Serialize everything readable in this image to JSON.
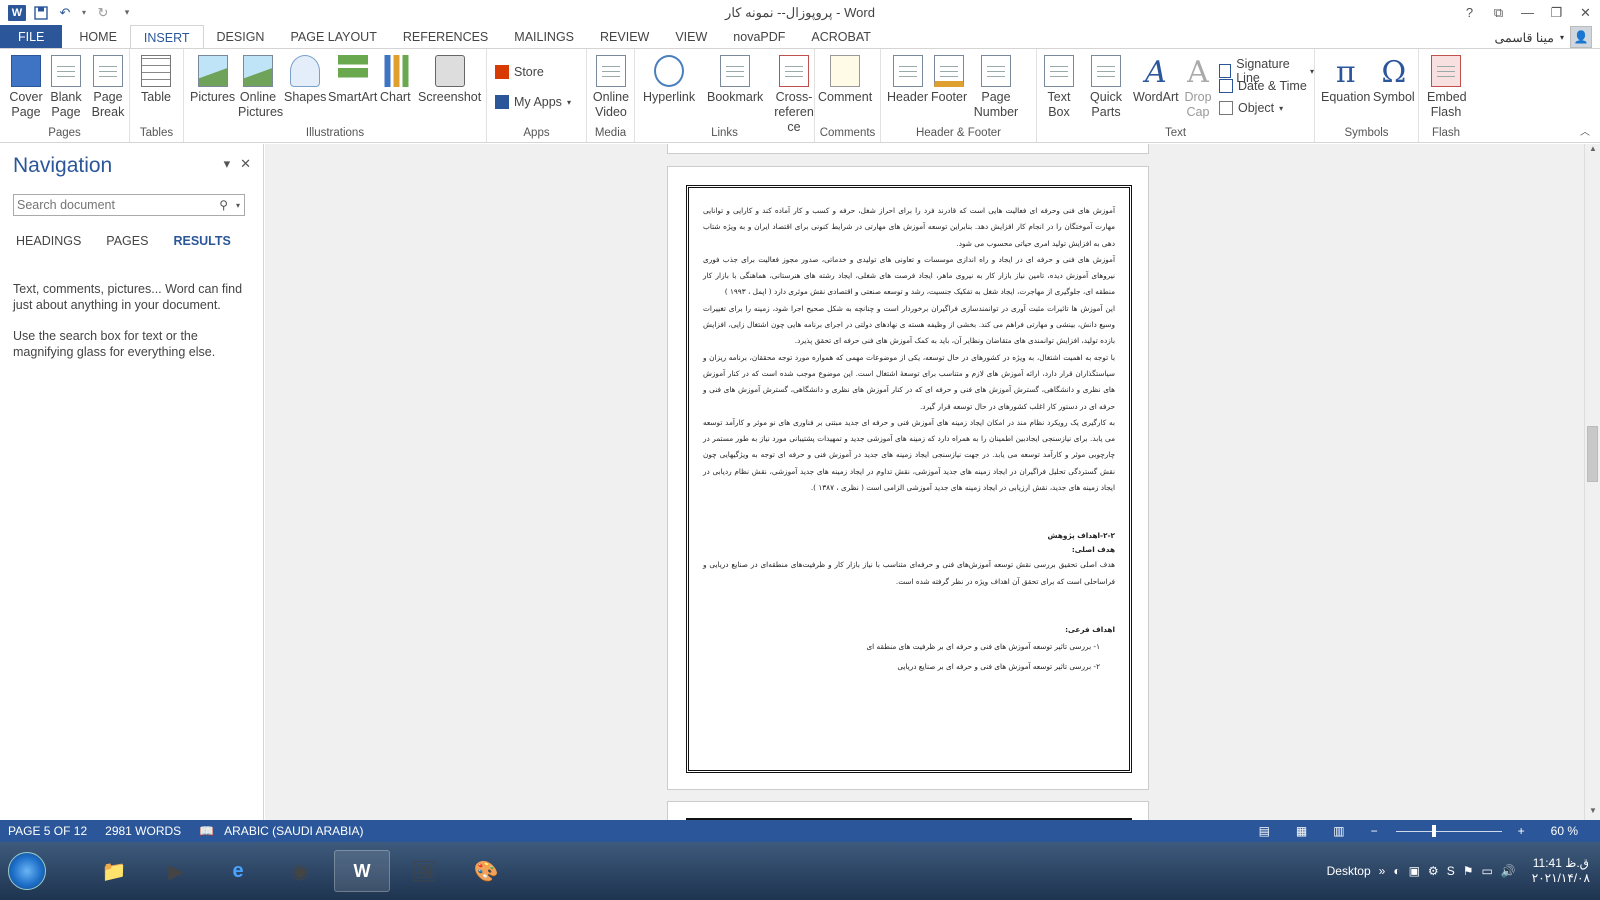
{
  "titlebar": {
    "title": "پروپوزال-- نمونه کار - Word",
    "word_logo": "W",
    "help": "?",
    "restore_ribbon": "⧉",
    "minimize": "—",
    "maximize": "❐",
    "close": "✕"
  },
  "tabs": [
    {
      "label": "FILE"
    },
    {
      "label": "HOME"
    },
    {
      "label": "INSERT"
    },
    {
      "label": "DESIGN"
    },
    {
      "label": "PAGE LAYOUT"
    },
    {
      "label": "REFERENCES"
    },
    {
      "label": "MAILINGS"
    },
    {
      "label": "REVIEW"
    },
    {
      "label": "VIEW"
    },
    {
      "label": "novaPDF"
    },
    {
      "label": "ACROBAT"
    }
  ],
  "active_tab": "INSERT",
  "user": {
    "name": "مینا قاسمی"
  },
  "ribbon": {
    "groups": {
      "pages": "Pages",
      "tables": "Tables",
      "illustrations": "Illustrations",
      "apps": "Apps",
      "media": "Media",
      "links": "Links",
      "comments": "Comments",
      "header_footer": "Header & Footer",
      "text": "Text",
      "symbols": "Symbols",
      "flash": "Flash"
    },
    "buttons": {
      "cover_page": "Cover Page",
      "blank_page": "Blank Page",
      "page_break": "Page Break",
      "table": "Table",
      "pictures": "Pictures",
      "online_pictures": "Online Pictures",
      "shapes": "Shapes",
      "smartart": "SmartArt",
      "chart": "Chart",
      "screenshot": "Screenshot",
      "store": "Store",
      "my_apps": "My Apps",
      "online_video": "Online Video",
      "hyperlink": "Hyperlink",
      "bookmark": "Bookmark",
      "cross_reference": "Cross-reference",
      "comment": "Comment",
      "header": "Header",
      "footer": "Footer",
      "page_number": "Page Number",
      "text_box": "Text Box",
      "quick_parts": "Quick Parts",
      "wordart": "WordArt",
      "drop_cap": "Drop Cap",
      "signature_line": "Signature Line",
      "date_time": "Date & Time",
      "object": "Object",
      "equation": "Equation",
      "symbol": "Symbol",
      "embed_flash": "Embed Flash"
    }
  },
  "navigation": {
    "title": "Navigation",
    "search_placeholder": "Search document",
    "tabs": [
      "HEADINGS",
      "PAGES",
      "RESULTS"
    ],
    "help1": "Text, comments, pictures... Word can find just about anything in your document.",
    "help2": "Use the search box for text or the magnifying glass for everything else."
  },
  "document": {
    "paragraphs": [
      "آموزش های فنی وحرفه ای فعالیت هایی است که قادرند فرد را برای احراز شغل، حرفه و کسب و کار آماده کند و کارایی و توانایی مهارت آموختگان را در انجام کار افزایش دهد. بنابراین توسعه آموزش های مهارتی در شرایط کنونی برای اقتصاد ایران و به ویژه شتاب دهی به افزایش تولید امری حیاتی محسوب می شود.",
      "آموزش های فنی و حرفه ای در ایجاد و راه اندازی موسسات و تعاونی های تولیدی و خدماتی، صدور مجوز فعالیت برای جذب فوری نیروهای آموزش دیده، تامین نیاز بازار کار به نیروی ماهر، ایجاد فرصت های شغلی، ایجاد رشته های هنرستانی، هماهنگی با بازار کار منطقه ای، جلوگیری از مهاجرت، ایجاد شغل به تفکیک جنسیت، رشد و توسعه صنعتی و اقتصادی نقش موثری دارد ( اپمل ، ۱۹۹۳ )",
      "این آموزش ها تاثیرات مثبت آوری در توانمندسازی فراگیران برخوردار است و چنانچه به شکل صحیح اجرا شود، زمینه را برای تغییرات وسیع دانش، بینشی و مهارتی فراهم می کند. بخشی از وظیفه هسته ی نهادهای دولتی در اجرای برنامه هایی چون اشتغال زایی، افزایش بازده تولید، افزایش توانمندی های متقاضان ونظایر آن، باید به کمک آموزش های فنی حرفه ای تحقق پذیرد.",
      "با توجه به اهمیت اشتغال، به ویژه در کشورهای در حال توسعه، یکی از موضوعات مهمی که همواره مورد توجه محققان، برنامه ریزان و سیاستگذاران قرار دارد، ارائه آموزش های لازم و متناسب برای توسعۀ اشتغال است. این موضوع موجب شده است که در کنار آموزش های نظری و دانشگاهی، گسترش آموزش های فنی و حرفه ای که در کنار آموزش های نظری و دانشگاهی، گسترش آموزش های فنی و حرفه ای در دستور کار اغلب کشورهای در حال توسعه قرار گیرد.",
      "به کارگیری یک رویکرد نظام مند در امکان ایجاد زمینه های آموزش فنی و حرفه ای جدید مبتنی بر فناوری های نو موثر و کارآمد توسعه می یابد. برای نیازسنجی ایجادبین اطمینان را به همراه دارد که زمینه های آموزشی جدید و تمهیدات پشتیبانی مورد نیاز به طور مستمر در چارچوبی موثر و کارآمد توسعه می یابد. در جهت نیازسنجی ایجاد زمینه های جدید در آموزش فنی و حرفه ای توجه به ویژگیهایی چون نقش گستردگی تحلیل فراگیران در ایجاد زمینه های جدید آموزشی، نقش تداوم در ایجاد زمینه های جدید آموزشی، نقش نظام ردیابی در ایجاد زمینه های جدید، نقش ارزیابی در ایجاد زمینه های جدید آموزشی الزامی است ( نظری ، ۱۳۸۷ )."
    ],
    "section_heading": "۲-۲-اهداف پژوهش",
    "main_goal_label": "هدف اصلی:",
    "main_goal": "هدف اصلی تحقیق بررسی نقش توسعه آموزش‌های فنی و حرفه‌ای متناسب با نیاز بازار کار و ظرفیت‌های منطقه‌ای در صنایع دریایی و فراساحلی است که برای تحقق آن اهداف ویژه در نظر گرفته شده است.",
    "sub_goals_label": "اهداف فرعی:",
    "sub_goals": [
      "۱- بررسی تاثیر توسعه آموزش های فنی و حرفه ای بر ظرفیت های منطقه ای",
      "۲- بررسی تاثیر توسعه آموزش های فنی و حرفه ای بر صنایع دریایی"
    ]
  },
  "status": {
    "page": "PAGE 5 OF 12",
    "words": "2981 WORDS",
    "language": "ARABIC (SAUDI ARABIA)",
    "zoom": "60 %",
    "zoom_fraction": 0.6
  },
  "taskbar": {
    "desktop": "Desktop",
    "time": "11:41 ق.ظ",
    "date": "۲۰۲۱/۱۴/۰۸"
  },
  "colors": {
    "accent": "#2b579a",
    "status_bar": "#2b579a"
  }
}
